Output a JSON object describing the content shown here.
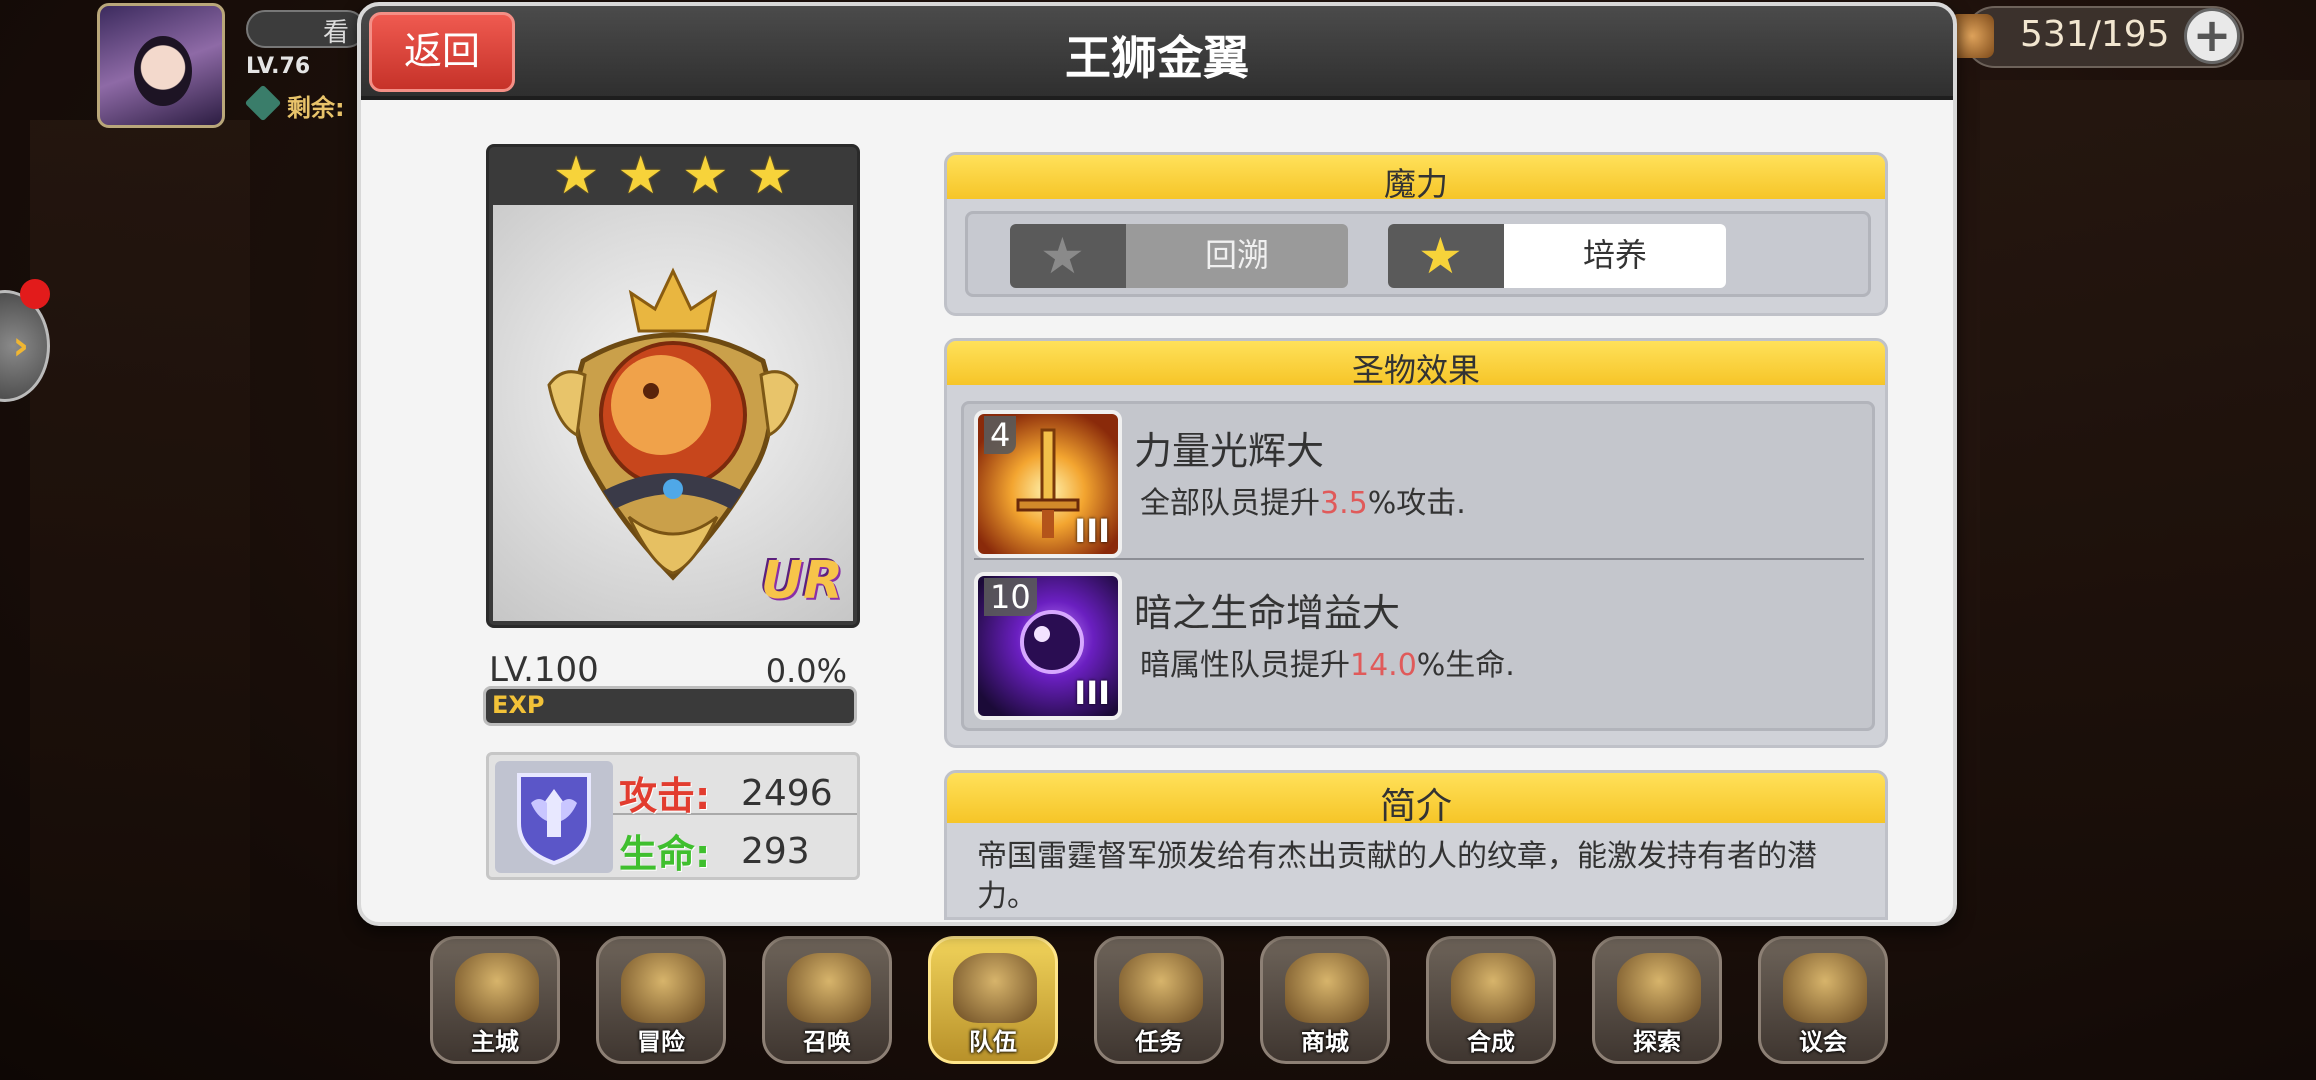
{
  "hud": {
    "view_label": "看",
    "level": "LV.76",
    "remain_label": "剩余:"
  },
  "resource": {
    "value": "531/195",
    "plus": "+"
  },
  "dialog": {
    "title": "王狮金翼",
    "back_label": "返回"
  },
  "item": {
    "stars": 4,
    "star_glyph": "★",
    "rarity": "UR",
    "level": "LV.100",
    "exp_percent": "0.0%",
    "exp_fraction": 0.0,
    "exp_label": "EXP"
  },
  "stats": {
    "attack_label": "攻击:",
    "attack_value": "2496",
    "hp_label": "生命:",
    "hp_value": "293"
  },
  "magic": {
    "title": "魔力",
    "rewind_label": "回溯",
    "train_label": "培养"
  },
  "effects": {
    "title": "圣物效果",
    "items": [
      {
        "count": "4",
        "tier": "III",
        "name": "力量光辉大",
        "desc_pre": "全部队员提升",
        "desc_value": "3.5",
        "desc_post": "%攻击."
      },
      {
        "count": "10",
        "tier": "III",
        "name": "暗之生命增益大",
        "desc_pre": "暗属性队员提升",
        "desc_value": "14.0",
        "desc_post": "%生命."
      }
    ]
  },
  "intro": {
    "title": "简介",
    "text": "帝国雷霆督军颁发给有杰出贡献的人的纹章，能激发持有者的潜力。"
  },
  "nav": {
    "items": [
      {
        "label": "主城",
        "icon": "castle-icon",
        "active": false
      },
      {
        "label": "冒险",
        "icon": "crossed-axes-icon",
        "active": false
      },
      {
        "label": "召唤",
        "icon": "summon-card-icon",
        "active": false
      },
      {
        "label": "队伍",
        "icon": "winged-helmet-icon",
        "active": true
      },
      {
        "label": "任务",
        "icon": "scroll-book-icon",
        "active": false
      },
      {
        "label": "商城",
        "icon": "shop-tree-icon",
        "active": false
      },
      {
        "label": "合成",
        "icon": "potion-flask-icon",
        "active": false
      },
      {
        "label": "探索",
        "icon": "shovel-icon",
        "active": false
      },
      {
        "label": "议会",
        "icon": "council-crest-icon",
        "active": false
      }
    ]
  },
  "colors": {
    "accent_yellow": "#f6c528",
    "back_red": "#d8423a",
    "attack_red": "#e23c2f",
    "hp_green": "#3fbf2e",
    "highlight_red": "#e05a5a"
  }
}
